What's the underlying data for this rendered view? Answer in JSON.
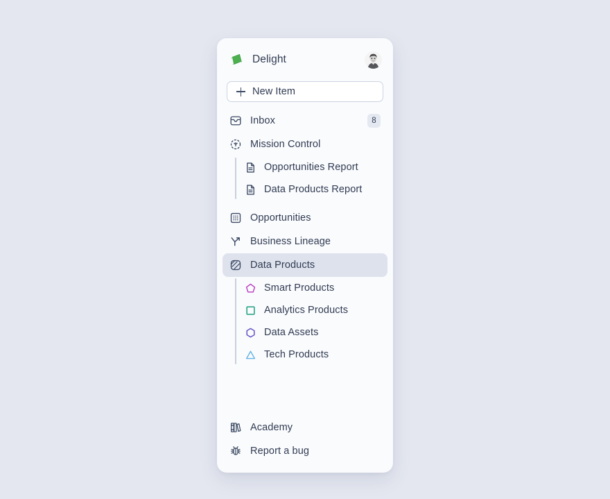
{
  "app": {
    "name": "Delight",
    "logo_icon": "delight-leaf-logo",
    "avatar_icon": "user-avatar-photo"
  },
  "new_item": {
    "label": "New Item",
    "icon": "plus-icon"
  },
  "nav": {
    "inbox": {
      "label": "Inbox",
      "icon": "inbox-icon",
      "badge": "8"
    },
    "mission_control": {
      "label": "Mission Control",
      "icon": "mission-control-icon",
      "children": [
        {
          "label": "Opportunities Report",
          "icon": "document-icon"
        },
        {
          "label": "Data Products Report",
          "icon": "document-icon"
        }
      ]
    },
    "opportunities": {
      "label": "Opportunities",
      "icon": "grid-dots-icon"
    },
    "business_lineage": {
      "label": "Business Lineage",
      "icon": "lineage-branch-icon"
    },
    "data_products": {
      "label": "Data Products",
      "icon": "data-products-icon",
      "active": true,
      "children": [
        {
          "label": "Smart Products",
          "icon": "pentagon-icon",
          "color": "#b83bbd"
        },
        {
          "label": "Analytics Products",
          "icon": "square-icon",
          "color": "#1e9e7e"
        },
        {
          "label": "Data Assets",
          "icon": "hexagon-icon",
          "color": "#5b4bc4"
        },
        {
          "label": "Tech Products",
          "icon": "triangle-icon",
          "color": "#63b3e8"
        }
      ]
    }
  },
  "footer": {
    "academy": {
      "label": "Academy",
      "icon": "books-icon"
    },
    "report_bug": {
      "label": "Report a bug",
      "icon": "bug-icon"
    }
  },
  "colors": {
    "page_background": "#e4e7ef",
    "panel_background": "#fafbfd",
    "text": "#303b52",
    "active_item_background": "#dde2ec",
    "badge_background": "#e4e8f0",
    "logo_green": "#4caf50"
  }
}
